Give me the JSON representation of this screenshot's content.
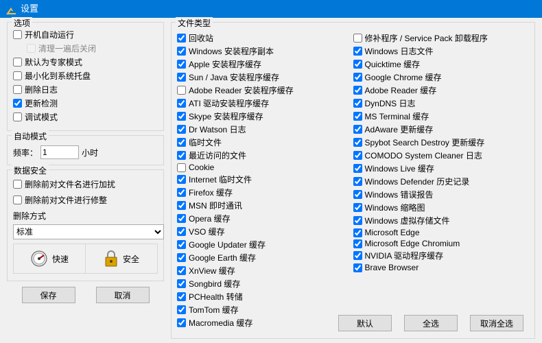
{
  "window": {
    "title": "设置"
  },
  "left": {
    "options_title": "选项",
    "opts": [
      {
        "label": "开机自动运行",
        "checked": false
      },
      {
        "label": "清理一遍后关闭",
        "checked": false,
        "sub": true,
        "disabled": true
      },
      {
        "label": "默认为专家模式",
        "checked": false
      },
      {
        "label": "最小化到系统托盘",
        "checked": false
      },
      {
        "label": "删除日志",
        "checked": false
      },
      {
        "label": "更新检测",
        "checked": true
      },
      {
        "label": "调试模式",
        "checked": false
      }
    ],
    "auto_title": "自动模式",
    "freq_label": "频率：",
    "freq_value": 1,
    "freq_unit": "小时",
    "sec_title": "数据安全",
    "sec_opts": [
      {
        "label": "删除前对文件名进行加扰",
        "checked": false
      },
      {
        "label": "删除前对文件进行修整",
        "checked": false
      }
    ],
    "method_label": "删除方式",
    "method_selected": "标准",
    "speed_fast": "快速",
    "speed_safe": "安全",
    "save": "保存",
    "cancel": "取消"
  },
  "ft": {
    "title": "文件类型",
    "col1": [
      {
        "label": "回收站",
        "checked": true
      },
      {
        "label": "Windows 安装程序副本",
        "checked": true
      },
      {
        "label": "Apple 安装程序缓存",
        "checked": true
      },
      {
        "label": "Sun / Java 安装程序缓存",
        "checked": true
      },
      {
        "label": "Adobe Reader 安装程序缓存",
        "checked": false
      },
      {
        "label": "ATI 驱动安装程序缓存",
        "checked": true
      },
      {
        "label": "Skype 安装程序缓存",
        "checked": true
      },
      {
        "label": "Dr Watson 日志",
        "checked": true
      },
      {
        "label": "临时文件",
        "checked": true
      },
      {
        "label": "最近访问的文件",
        "checked": true
      },
      {
        "label": "Cookie",
        "checked": false
      },
      {
        "label": "Internet 临时文件",
        "checked": true
      },
      {
        "label": "Firefox 缓存",
        "checked": true
      },
      {
        "label": "MSN 即时通讯",
        "checked": true
      },
      {
        "label": "Opera 缓存",
        "checked": true
      },
      {
        "label": "VSO 缓存",
        "checked": true
      },
      {
        "label": "Google Updater 缓存",
        "checked": true
      },
      {
        "label": "Google Earth 缓存",
        "checked": true
      },
      {
        "label": "XnView 缓存",
        "checked": true
      },
      {
        "label": "Songbird 缓存",
        "checked": true
      },
      {
        "label": "PCHealth 转储",
        "checked": true
      },
      {
        "label": "TomTom 缓存",
        "checked": true
      },
      {
        "label": "Macromedia 缓存",
        "checked": true
      }
    ],
    "col2": [
      {
        "label": "修补程序 / Service Pack 卸载程序",
        "checked": false
      },
      {
        "label": "Windows 日志文件",
        "checked": true
      },
      {
        "label": "Quicktime 缓存",
        "checked": true
      },
      {
        "label": "Google Chrome 缓存",
        "checked": true
      },
      {
        "label": "Adobe Reader 缓存",
        "checked": true
      },
      {
        "label": "DynDNS 日志",
        "checked": true
      },
      {
        "label": "MS Terminal 缓存",
        "checked": true
      },
      {
        "label": "AdAware 更新缓存",
        "checked": true
      },
      {
        "label": "Spybot Search  Destroy 更新缓存",
        "checked": true
      },
      {
        "label": "COMODO System Cleaner 日志",
        "checked": true
      },
      {
        "label": "Windows Live 缓存",
        "checked": true
      },
      {
        "label": "Windows Defender 历史记录",
        "checked": true
      },
      {
        "label": "Windows 错误报告",
        "checked": true
      },
      {
        "label": "Windows 缩略图",
        "checked": true
      },
      {
        "label": "Windows 虚拟存储文件",
        "checked": true
      },
      {
        "label": "Microsoft Edge",
        "checked": true
      },
      {
        "label": "Microsoft Edge Chromium",
        "checked": true
      },
      {
        "label": "NVIDIA 驱动程序缓存",
        "checked": true
      },
      {
        "label": "Brave Browser",
        "checked": true
      }
    ],
    "btn_default": "默认",
    "btn_all": "全选",
    "btn_none": "取消全选"
  }
}
